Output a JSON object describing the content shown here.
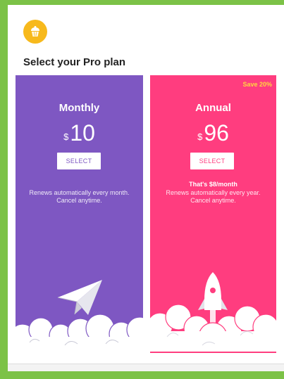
{
  "dialog": {
    "title": "Select your Pro plan",
    "logo_icon": "cupcake-icon"
  },
  "plans": {
    "monthly": {
      "name": "Monthly",
      "currency": "$",
      "amount": "10",
      "button_label": "SELECT",
      "note_line1": "Renews automatically every month.",
      "note_line2": "Cancel anytime.",
      "color": "#7e57c2",
      "illustration_icon": "paper-plane-icon"
    },
    "annual": {
      "badge": "Save 20%",
      "name": "Annual",
      "currency": "$",
      "amount": "96",
      "button_label": "SELECT",
      "highlight": "That's $8/month",
      "note_line1": "Renews automatically every year.",
      "note_line2": "Cancel anytime.",
      "color": "#ff3d7f",
      "badge_color": "#ffd740",
      "illustration_icon": "rocket-icon"
    }
  },
  "colors": {
    "frame": "#7cc247",
    "logo": "#f7b91c"
  }
}
